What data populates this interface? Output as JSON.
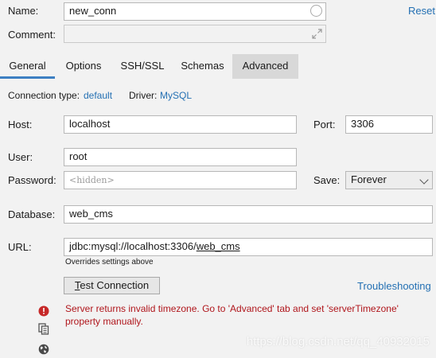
{
  "header": {
    "name_label": "Name:",
    "name_value": "new_conn",
    "reset_label": "Reset",
    "comment_label": "Comment:",
    "comment_value": ""
  },
  "tabs": [
    {
      "label": "General",
      "active": true
    },
    {
      "label": "Options",
      "active": false
    },
    {
      "label": "SSH/SSL",
      "active": false
    },
    {
      "label": "Schemas",
      "active": false
    },
    {
      "label": "Advanced",
      "active": false,
      "hover": true
    }
  ],
  "general": {
    "connection_type_label": "Connection type:",
    "connection_type_value": "default",
    "driver_label": "Driver:",
    "driver_value": "MySQL",
    "host_label": "Host:",
    "host_value": "localhost",
    "port_label": "Port:",
    "port_value": "3306",
    "user_label": "User:",
    "user_value": "root",
    "password_label": "Password:",
    "password_placeholder": "<hidden>",
    "save_label": "Save:",
    "save_value": "Forever",
    "database_label": "Database:",
    "database_value": "web_cms",
    "url_label": "URL:",
    "url_prefix": "jdbc:mysql://localhost:3306/",
    "url_db": "web_cms",
    "url_note": "Overrides settings above",
    "test_connection_first": "T",
    "test_connection_rest": "est Connection",
    "troubleshooting_label": "Troubleshooting",
    "error_message": "Server returns invalid timezone. Go to 'Advanced' tab and set 'serverTimezone' property manually."
  },
  "colors": {
    "link": "#2470b3",
    "error": "#b0161c",
    "tab_active_underline": "#3d7fc2",
    "background": "#f2f2f2"
  },
  "icons": [
    "circle-icon",
    "expand-icon",
    "chevron-down-icon",
    "error-icon",
    "copy-icon",
    "globe-icon"
  ],
  "watermark": "https://blog.csdn.net/qq_40932015"
}
